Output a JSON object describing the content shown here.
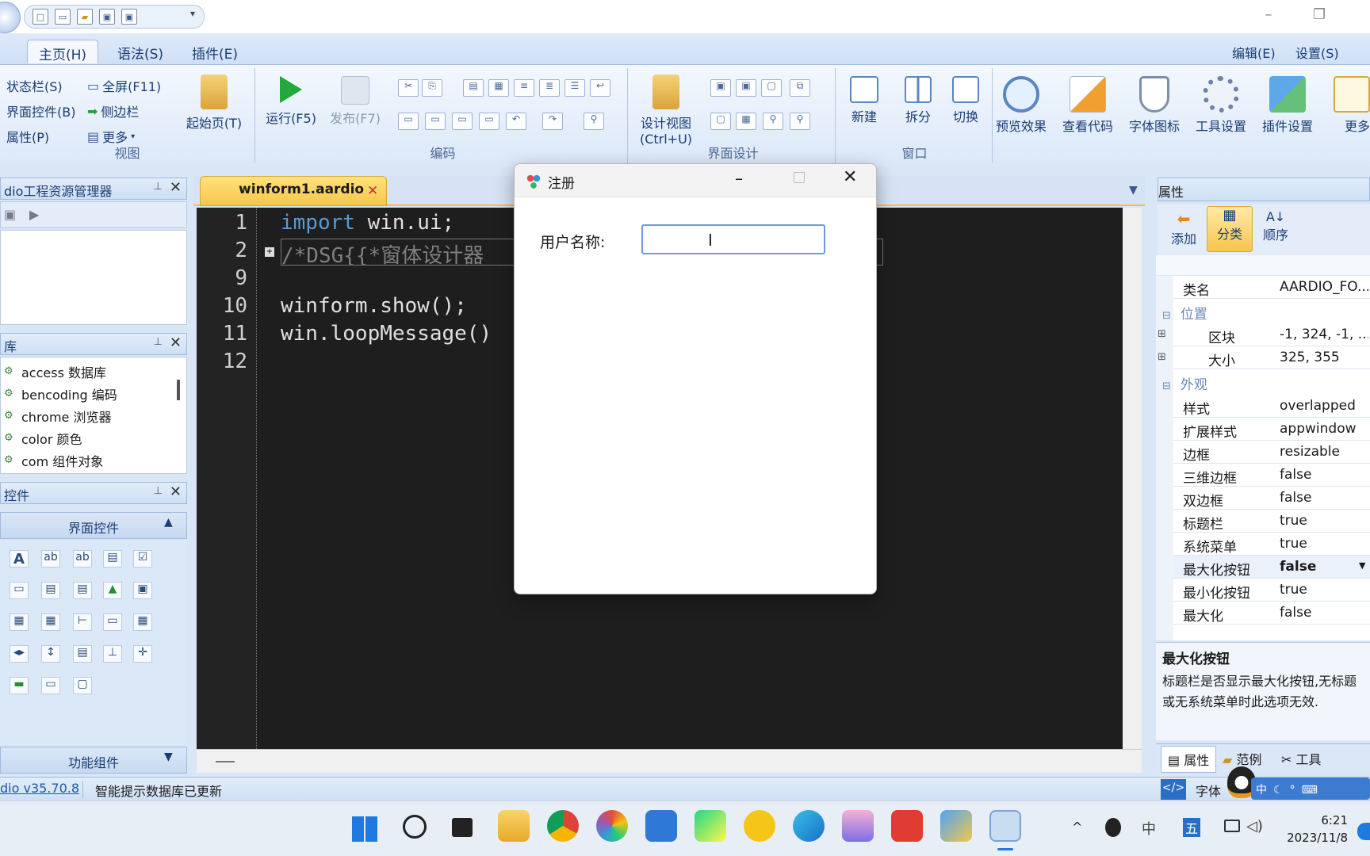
{
  "ribbon_tabs": [
    "主页(H)",
    "语法(S)",
    "插件(E)"
  ],
  "top_right": {
    "edit": "编辑(E)",
    "settings": "设置(S)"
  },
  "view_group": {
    "status_bar": "状态栏(S)",
    "ui_controls": "界面控件(B)",
    "properties": "属性(P)",
    "fullscreen": "全屏(F11)",
    "sidebar": "侧边栏",
    "more": "更多",
    "start_page": "起始页(T)",
    "label": "视图"
  },
  "code_group": {
    "run": "运行(F5)",
    "publish": "发布(F7)",
    "label": "编码"
  },
  "design_group": {
    "design_view": "设计视图",
    "design_view_shortcut": "(Ctrl+U)",
    "label": "界面设计"
  },
  "window_group": {
    "new": "新建",
    "split": "拆分",
    "switch": "切换",
    "label": "窗口"
  },
  "big_buttons": [
    "预览效果",
    "查看代码",
    "字体图标",
    "工具设置",
    "插件设置",
    "更多"
  ],
  "resource_manager": {
    "title": "dio工程资源管理器"
  },
  "library_panel": {
    "title": "库",
    "items": [
      "access 数据库",
      "bencoding 编码",
      "chrome 浏览器",
      "color 颜色",
      "com 组件对象"
    ]
  },
  "controls_panel": {
    "title": "控件",
    "section": "界面控件",
    "footer": "功能组件"
  },
  "editor": {
    "tab": "winform1.aardio",
    "line_numbers": [
      "1",
      "2",
      "9",
      "10",
      "11",
      "12"
    ],
    "lines": {
      "l1_kw": "import",
      "l1_rest": " win.ui;",
      "l2": "/*DSG{{*窗体设计器",
      "l10": "winform.show();",
      "l11": "win.loopMessage()"
    }
  },
  "dialog": {
    "title": "注册",
    "label": "用户名称:",
    "input_value": ""
  },
  "properties_panel": {
    "title": "属性",
    "buttons": [
      "添加",
      "分类",
      "顺序"
    ],
    "class_name_key": "类名",
    "class_name_value": "AARDIO_FO...",
    "category_position": "位置",
    "position_rows": [
      {
        "key": "区块",
        "value": "-1, 324, -1, ..."
      },
      {
        "key": "大小",
        "value": "325, 355"
      }
    ],
    "category_appearance": "外观",
    "rows": [
      {
        "key": "样式",
        "value": "overlapped"
      },
      {
        "key": "扩展样式",
        "value": "appwindow"
      },
      {
        "key": "边框",
        "value": "resizable"
      },
      {
        "key": "三维边框",
        "value": "false"
      },
      {
        "key": "双边框",
        "value": "false"
      },
      {
        "key": "标题栏",
        "value": "true"
      },
      {
        "key": "系统菜单",
        "value": "true"
      },
      {
        "key": "最大化按钮",
        "value": "false"
      },
      {
        "key": "最小化按钮",
        "value": "true"
      },
      {
        "key": "最大化",
        "value": "false"
      }
    ],
    "desc_title": "最大化按钮",
    "desc_text_1": "标题栏是否显示最大化按钮,无标题",
    "desc_text_2": "或无系统菜单时此选项无效.",
    "bottom_tabs": [
      "属性",
      "范例",
      "工具"
    ]
  },
  "statusbar": {
    "version": "dio v35.70.8",
    "message": "智能提示数据库已更新",
    "font_label": "字体"
  },
  "ime": {
    "lang": "中"
  },
  "taskbar": {
    "time": "6:21",
    "date": "2023/11/8",
    "tray_lang": "中",
    "tray_wubi": "五"
  }
}
